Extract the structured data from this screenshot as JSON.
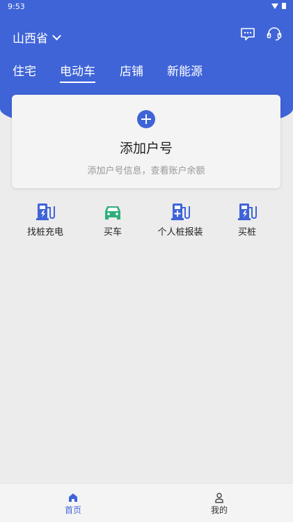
{
  "status_bar": {
    "time": "9:53"
  },
  "header": {
    "region": "山西省"
  },
  "tabs": [
    {
      "label": "住宅",
      "active": false
    },
    {
      "label": "电动车",
      "active": true
    },
    {
      "label": "店铺",
      "active": false
    },
    {
      "label": "新能源",
      "active": false
    }
  ],
  "account_card": {
    "title": "添加户号",
    "subtitle": "添加户号信息，查看账户余额"
  },
  "services": [
    {
      "label": "找桩充电",
      "icon": "charging-station-icon"
    },
    {
      "label": "买车",
      "icon": "car-icon"
    },
    {
      "label": "个人桩报装",
      "icon": "charger-install-icon"
    },
    {
      "label": "买桩",
      "icon": "buy-charger-icon"
    }
  ],
  "bottom_nav": [
    {
      "label": "首页",
      "active": true
    },
    {
      "label": "我的",
      "active": false
    }
  ],
  "colors": {
    "primary": "#3f64d8",
    "car_green": "#2fae7c",
    "background": "#ececec"
  }
}
